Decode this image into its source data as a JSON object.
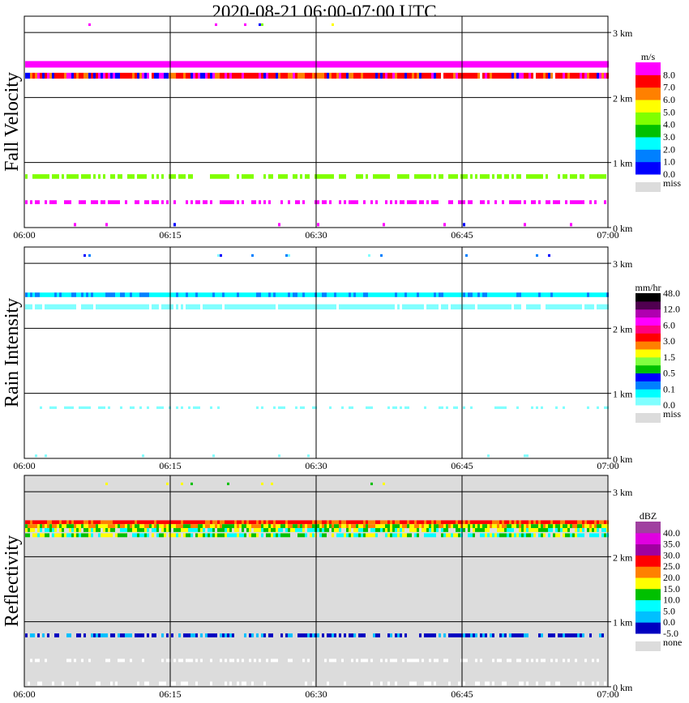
{
  "title": "2020-08-21   06:00-07:00 UTC",
  "chart_data": [
    {
      "type": "heatmap",
      "ylabel": "Fall Velocity",
      "x_ticks": [
        "06:00",
        "06:15",
        "06:30",
        "06:45",
        "07:00"
      ],
      "y_ticks": [
        "0 km",
        "1 km",
        "2 km",
        "3 km"
      ],
      "ylim": [
        0,
        3.25
      ],
      "grid": true,
      "background": "#ffffff",
      "colorbar": {
        "unit": "m/s",
        "colors": [
          "#0000ff",
          "#0080ff",
          "#00ffff",
          "#00c000",
          "#80ff00",
          "#ffff00",
          "#ff8000",
          "#ff0000",
          "#ff00ff"
        ],
        "labels": [
          "0.0",
          "1.0",
          "2.0",
          "3.0",
          "4.0",
          "5.0",
          "6.0",
          "7.0",
          "8.0"
        ],
        "missing_label": "miss",
        "missing_color": "#dcdcdc"
      },
      "bands": [
        {
          "km": [
            2.46,
            2.56
          ],
          "cover": 1.0,
          "colors": [
            "#ff00ff"
          ]
        },
        {
          "km": [
            2.29,
            2.38
          ],
          "cover": 0.98,
          "colors": [
            "#ff0000",
            "#ff0000",
            "#ff0000",
            "#ff00ff",
            "#ff8000",
            "#0000ff"
          ]
        },
        {
          "km": [
            0.75,
            0.82
          ],
          "cover": 0.7,
          "colors": [
            "#80ff00"
          ]
        },
        {
          "km": [
            0.36,
            0.42
          ],
          "cover": 0.55,
          "colors": [
            "#ff00ff"
          ]
        },
        {
          "km": [
            0.02,
            0.07
          ],
          "cover": 0.06,
          "colors": [
            "#ff00ff",
            "#0000ff"
          ]
        },
        {
          "km": [
            3.1,
            3.14
          ],
          "cover": 0.04,
          "colors": [
            "#ff00ff",
            "#ffff00",
            "#80ff00",
            "#0000ff"
          ]
        }
      ]
    },
    {
      "type": "heatmap",
      "ylabel": "Rain Intensity",
      "x_ticks": [
        "06:00",
        "06:15",
        "06:30",
        "06:45",
        "07:00"
      ],
      "y_ticks": [
        "0 km",
        "1 km",
        "2 km",
        "3 km"
      ],
      "ylim": [
        0,
        3.25
      ],
      "grid": true,
      "background": "#ffffff",
      "colorbar": {
        "unit": "mm/hr",
        "colors": [
          "#80ffff",
          "#00ffff",
          "#0080ff",
          "#0000ff",
          "#00c000",
          "#80ff40",
          "#ffff00",
          "#ff8000",
          "#ff0000",
          "#ff0080",
          "#ff00ff",
          "#b000b0",
          "#500050",
          "#000000"
        ],
        "labels": [
          "0.0",
          "0.1",
          "0.5",
          "1.5",
          "3.0",
          "6.0",
          "12.0",
          "48.0"
        ],
        "missing_label": "miss",
        "missing_color": "#dcdcdc"
      },
      "bands": [
        {
          "km": [
            2.48,
            2.55
          ],
          "cover": 1.0,
          "colors": [
            "#00ffff",
            "#00ffff",
            "#00ffff",
            "#0080ff"
          ]
        },
        {
          "km": [
            2.29,
            2.37
          ],
          "cover": 0.9,
          "colors": [
            "#80ffff"
          ]
        },
        {
          "km": [
            0.76,
            0.8
          ],
          "cover": 0.35,
          "colors": [
            "#80ffff"
          ]
        },
        {
          "km": [
            0.02,
            0.06
          ],
          "cover": 0.04,
          "colors": [
            "#80ffff"
          ]
        },
        {
          "km": [
            3.1,
            3.14
          ],
          "cover": 0.03,
          "colors": [
            "#80ffff",
            "#0080ff",
            "#0000ff"
          ]
        }
      ]
    },
    {
      "type": "heatmap",
      "ylabel": "Reflectivity",
      "x_ticks": [
        "06:00",
        "06:15",
        "06:30",
        "06:45",
        "07:00"
      ],
      "y_ticks": [
        "0 km",
        "1 km",
        "2 km",
        "3 km"
      ],
      "ylim": [
        0,
        3.25
      ],
      "grid": true,
      "background": "#dcdcdc",
      "colorbar": {
        "unit": "dBZ",
        "colors": [
          "#0000c0",
          "#00c0ff",
          "#00ffff",
          "#00c000",
          "#ffff00",
          "#ff8000",
          "#ff0000",
          "#a000a0",
          "#e000e0",
          "#a040a0"
        ],
        "labels": [
          "-5.0",
          "0.0",
          "5.0",
          "10.0",
          "15.0",
          "20.0",
          "25.0",
          "30.0",
          "35.0",
          "40.0"
        ],
        "missing_label": "none",
        "missing_color": "#dcdcdc"
      },
      "bands": [
        {
          "km": [
            2.5,
            2.56
          ],
          "cover": 1.0,
          "colors": [
            "#ff0000",
            "#ff0000",
            "#ff8000"
          ]
        },
        {
          "km": [
            2.44,
            2.5
          ],
          "cover": 1.0,
          "colors": [
            "#ff8000",
            "#ffff00",
            "#00c000"
          ]
        },
        {
          "km": [
            2.38,
            2.44
          ],
          "cover": 0.8,
          "colors": [
            "#ffff00",
            "#00c000",
            "#00ffff"
          ]
        },
        {
          "km": [
            2.3,
            2.36
          ],
          "cover": 0.85,
          "colors": [
            "#00ffff",
            "#ffff00",
            "#00c000"
          ]
        },
        {
          "km": [
            0.76,
            0.82
          ],
          "cover": 0.6,
          "colors": [
            "#0000c0",
            "#00c0ff",
            "#0000c0"
          ]
        },
        {
          "km": [
            0.38,
            0.43
          ],
          "cover": 0.4,
          "colors": [
            "#ffffff"
          ]
        },
        {
          "km": [
            0.02,
            0.08
          ],
          "cover": 0.3,
          "colors": [
            "#ffffff"
          ]
        },
        {
          "km": [
            3.1,
            3.14
          ],
          "cover": 0.03,
          "colors": [
            "#00c000",
            "#ffff00"
          ]
        }
      ]
    }
  ]
}
